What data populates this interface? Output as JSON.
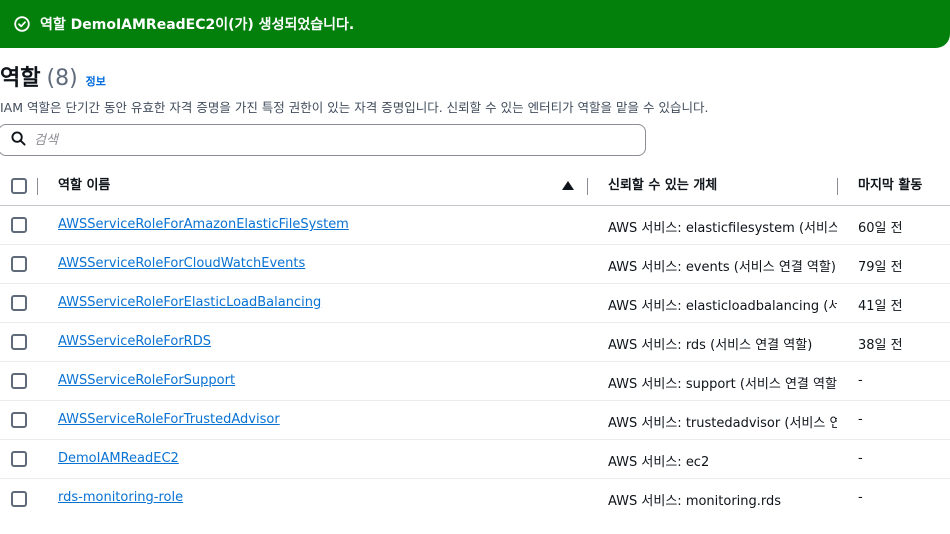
{
  "flash": {
    "message": "역할 DemoIAMReadEC2이(가) 생성되었습니다."
  },
  "header": {
    "title": "역할",
    "count": "(8)",
    "info": "정보",
    "description": "IAM 역할은 단기간 동안 유효한 자격 증명을 가진 특정 권한이 있는 자격 증명입니다. 신뢰할 수 있는 엔터티가 역할을 맡을 수 있습니다."
  },
  "search": {
    "placeholder": "검색"
  },
  "table": {
    "columns": {
      "name": "역할 이름",
      "trusted": "신뢰할 수 있는 개체",
      "last_activity": "마지막 활동"
    },
    "rows": [
      {
        "name": "AWSServiceRoleForAmazonElasticFileSystem",
        "trusted_prefix": "AWS 서비스: elasticfilesystem",
        "trusted_suffix": "서비스 연결 역할",
        "last": "60일 전"
      },
      {
        "name": "AWSServiceRoleForCloudWatchEvents",
        "trusted_prefix": "AWS 서비스: events",
        "trusted_suffix": "서비스 연결 역할",
        "last": "79일 전"
      },
      {
        "name": "AWSServiceRoleForElasticLoadBalancing",
        "trusted_prefix": "AWS 서비스: elasticloadbalancing",
        "trusted_suffix": "서비스 연결 역할",
        "last": "41일 전"
      },
      {
        "name": "AWSServiceRoleForRDS",
        "trusted_prefix": "AWS 서비스: rds",
        "trusted_suffix": "서비스 연결 역할",
        "last": "38일 전"
      },
      {
        "name": "AWSServiceRoleForSupport",
        "trusted_prefix": "AWS 서비스: support",
        "trusted_suffix": "서비스 연결 역할",
        "last": "-"
      },
      {
        "name": "AWSServiceRoleForTrustedAdvisor",
        "trusted_prefix": "AWS 서비스: trustedadvisor",
        "trusted_suffix": "서비스 연결 역할",
        "last": "-"
      },
      {
        "name": "DemoIAMReadEC2",
        "trusted_prefix": "AWS 서비스: ec2",
        "trusted_suffix": "",
        "last": "-"
      },
      {
        "name": "rds-monitoring-role",
        "trusted_prefix": "AWS 서비스: monitoring.rds",
        "trusted_suffix": "",
        "last": "-"
      }
    ]
  },
  "colors": {
    "success": "#037f0c",
    "link": "#0972d3"
  }
}
